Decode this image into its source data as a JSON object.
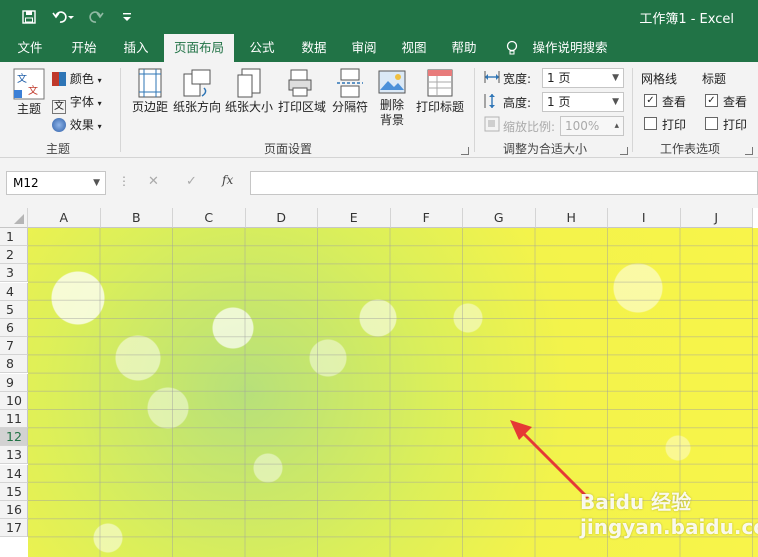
{
  "window": {
    "title": "工作簿1  -  Excel"
  },
  "tabs": [
    "文件",
    "开始",
    "插入",
    "页面布局",
    "公式",
    "数据",
    "审阅",
    "视图",
    "帮助"
  ],
  "tell_me": "操作说明搜索",
  "ribbon": {
    "theme_group": {
      "theme_label": "主题",
      "colors_label": "颜色",
      "fonts_label": "字体",
      "effects_label": "效果",
      "group_label": "主题"
    },
    "page_setup": {
      "margins": "页边距",
      "orientation": "纸张方向",
      "size": "纸张大小",
      "print_area": "打印区域",
      "breaks": "分隔符",
      "background_l1": "删除",
      "background_l2": "背景",
      "print_titles": "打印标题",
      "group_label": "页面设置"
    },
    "scale": {
      "width_label": "宽度:",
      "width_value": "1 页",
      "height_label": "高度:",
      "height_value": "1 页",
      "scale_label": "缩放比例:",
      "scale_value": "100%",
      "group_label": "调整为合适大小"
    },
    "sheet_options": {
      "gridlines": "网格线",
      "headings": "标题",
      "view": "查看",
      "print": "打印",
      "gridlines_view_checked": true,
      "gridlines_print_checked": false,
      "headings_view_checked": true,
      "headings_print_checked": false,
      "group_label": "工作表选项"
    }
  },
  "formula_bar": {
    "name_box": "M12",
    "fx": "fx",
    "formula": ""
  },
  "sheet": {
    "columns": [
      "A",
      "B",
      "C",
      "D",
      "E",
      "F",
      "G",
      "H",
      "I",
      "J"
    ],
    "rows": [
      "1",
      "2",
      "3",
      "4",
      "5",
      "6",
      "7",
      "8",
      "9",
      "10",
      "11",
      "12",
      "13",
      "14",
      "15",
      "16",
      "17"
    ],
    "selected_row": "12"
  },
  "colors": {
    "accent": "#217346",
    "annotation_arrow": "#e53935"
  },
  "watermark": "Baidu 经验  jingyan.baidu.com"
}
